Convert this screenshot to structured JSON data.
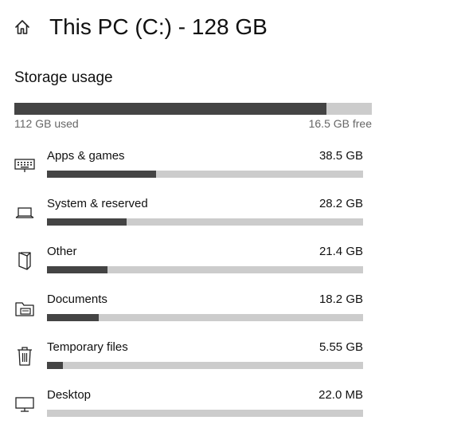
{
  "header": {
    "title": "This PC (C:) - 128 GB",
    "home_icon": "home-icon"
  },
  "storage": {
    "section_title": "Storage usage",
    "used_label": "112 GB used",
    "free_label": "16.5 GB free",
    "used_fraction": 0.872
  },
  "categories": [
    {
      "label": "Apps & games",
      "size": "38.5 GB",
      "fraction": 0.344,
      "icon": "keyboard-icon"
    },
    {
      "label": "System & reserved",
      "size": "28.2 GB",
      "fraction": 0.252,
      "icon": "laptop-icon"
    },
    {
      "label": "Other",
      "size": "21.4 GB",
      "fraction": 0.191,
      "icon": "other-files-icon"
    },
    {
      "label": "Documents",
      "size": "18.2 GB",
      "fraction": 0.163,
      "icon": "folder-icon"
    },
    {
      "label": "Temporary files",
      "size": "5.55 GB",
      "fraction": 0.05,
      "icon": "trash-icon"
    },
    {
      "label": "Desktop",
      "size": "22.0 MB",
      "fraction": 0.0,
      "icon": "monitor-icon"
    }
  ],
  "colors": {
    "bar_fill": "#444444",
    "bar_track": "#cccccc"
  }
}
